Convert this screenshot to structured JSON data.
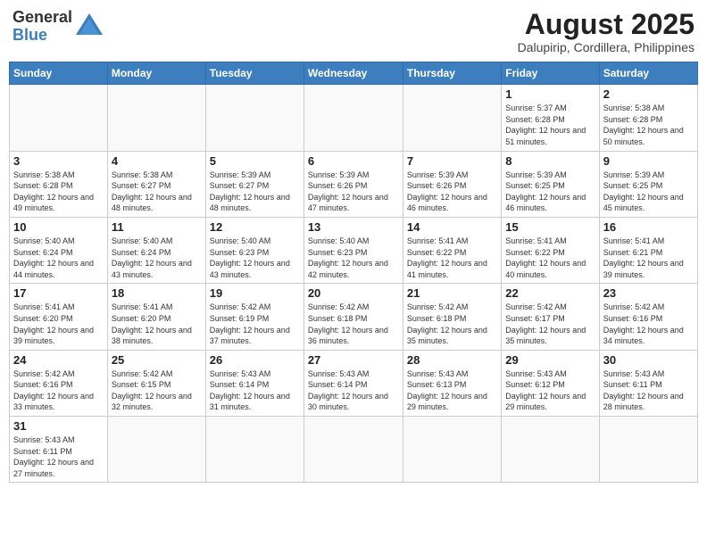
{
  "header": {
    "logo_general": "General",
    "logo_blue": "Blue",
    "month_title": "August 2025",
    "subtitle": "Dalupirip, Cordillera, Philippines"
  },
  "weekdays": [
    "Sunday",
    "Monday",
    "Tuesday",
    "Wednesday",
    "Thursday",
    "Friday",
    "Saturday"
  ],
  "weeks": [
    [
      {
        "day": "",
        "sunrise": "",
        "sunset": "",
        "daylight": ""
      },
      {
        "day": "",
        "sunrise": "",
        "sunset": "",
        "daylight": ""
      },
      {
        "day": "",
        "sunrise": "",
        "sunset": "",
        "daylight": ""
      },
      {
        "day": "",
        "sunrise": "",
        "sunset": "",
        "daylight": ""
      },
      {
        "day": "",
        "sunrise": "",
        "sunset": "",
        "daylight": ""
      },
      {
        "day": "1",
        "sunrise": "Sunrise: 5:37 AM",
        "sunset": "Sunset: 6:28 PM",
        "daylight": "Daylight: 12 hours and 51 minutes."
      },
      {
        "day": "2",
        "sunrise": "Sunrise: 5:38 AM",
        "sunset": "Sunset: 6:28 PM",
        "daylight": "Daylight: 12 hours and 50 minutes."
      }
    ],
    [
      {
        "day": "3",
        "sunrise": "Sunrise: 5:38 AM",
        "sunset": "Sunset: 6:28 PM",
        "daylight": "Daylight: 12 hours and 49 minutes."
      },
      {
        "day": "4",
        "sunrise": "Sunrise: 5:38 AM",
        "sunset": "Sunset: 6:27 PM",
        "daylight": "Daylight: 12 hours and 48 minutes."
      },
      {
        "day": "5",
        "sunrise": "Sunrise: 5:39 AM",
        "sunset": "Sunset: 6:27 PM",
        "daylight": "Daylight: 12 hours and 48 minutes."
      },
      {
        "day": "6",
        "sunrise": "Sunrise: 5:39 AM",
        "sunset": "Sunset: 6:26 PM",
        "daylight": "Daylight: 12 hours and 47 minutes."
      },
      {
        "day": "7",
        "sunrise": "Sunrise: 5:39 AM",
        "sunset": "Sunset: 6:26 PM",
        "daylight": "Daylight: 12 hours and 46 minutes."
      },
      {
        "day": "8",
        "sunrise": "Sunrise: 5:39 AM",
        "sunset": "Sunset: 6:25 PM",
        "daylight": "Daylight: 12 hours and 46 minutes."
      },
      {
        "day": "9",
        "sunrise": "Sunrise: 5:39 AM",
        "sunset": "Sunset: 6:25 PM",
        "daylight": "Daylight: 12 hours and 45 minutes."
      }
    ],
    [
      {
        "day": "10",
        "sunrise": "Sunrise: 5:40 AM",
        "sunset": "Sunset: 6:24 PM",
        "daylight": "Daylight: 12 hours and 44 minutes."
      },
      {
        "day": "11",
        "sunrise": "Sunrise: 5:40 AM",
        "sunset": "Sunset: 6:24 PM",
        "daylight": "Daylight: 12 hours and 43 minutes."
      },
      {
        "day": "12",
        "sunrise": "Sunrise: 5:40 AM",
        "sunset": "Sunset: 6:23 PM",
        "daylight": "Daylight: 12 hours and 43 minutes."
      },
      {
        "day": "13",
        "sunrise": "Sunrise: 5:40 AM",
        "sunset": "Sunset: 6:23 PM",
        "daylight": "Daylight: 12 hours and 42 minutes."
      },
      {
        "day": "14",
        "sunrise": "Sunrise: 5:41 AM",
        "sunset": "Sunset: 6:22 PM",
        "daylight": "Daylight: 12 hours and 41 minutes."
      },
      {
        "day": "15",
        "sunrise": "Sunrise: 5:41 AM",
        "sunset": "Sunset: 6:22 PM",
        "daylight": "Daylight: 12 hours and 40 minutes."
      },
      {
        "day": "16",
        "sunrise": "Sunrise: 5:41 AM",
        "sunset": "Sunset: 6:21 PM",
        "daylight": "Daylight: 12 hours and 39 minutes."
      }
    ],
    [
      {
        "day": "17",
        "sunrise": "Sunrise: 5:41 AM",
        "sunset": "Sunset: 6:20 PM",
        "daylight": "Daylight: 12 hours and 39 minutes."
      },
      {
        "day": "18",
        "sunrise": "Sunrise: 5:41 AM",
        "sunset": "Sunset: 6:20 PM",
        "daylight": "Daylight: 12 hours and 38 minutes."
      },
      {
        "day": "19",
        "sunrise": "Sunrise: 5:42 AM",
        "sunset": "Sunset: 6:19 PM",
        "daylight": "Daylight: 12 hours and 37 minutes."
      },
      {
        "day": "20",
        "sunrise": "Sunrise: 5:42 AM",
        "sunset": "Sunset: 6:18 PM",
        "daylight": "Daylight: 12 hours and 36 minutes."
      },
      {
        "day": "21",
        "sunrise": "Sunrise: 5:42 AM",
        "sunset": "Sunset: 6:18 PM",
        "daylight": "Daylight: 12 hours and 35 minutes."
      },
      {
        "day": "22",
        "sunrise": "Sunrise: 5:42 AM",
        "sunset": "Sunset: 6:17 PM",
        "daylight": "Daylight: 12 hours and 35 minutes."
      },
      {
        "day": "23",
        "sunrise": "Sunrise: 5:42 AM",
        "sunset": "Sunset: 6:16 PM",
        "daylight": "Daylight: 12 hours and 34 minutes."
      }
    ],
    [
      {
        "day": "24",
        "sunrise": "Sunrise: 5:42 AM",
        "sunset": "Sunset: 6:16 PM",
        "daylight": "Daylight: 12 hours and 33 minutes."
      },
      {
        "day": "25",
        "sunrise": "Sunrise: 5:42 AM",
        "sunset": "Sunset: 6:15 PM",
        "daylight": "Daylight: 12 hours and 32 minutes."
      },
      {
        "day": "26",
        "sunrise": "Sunrise: 5:43 AM",
        "sunset": "Sunset: 6:14 PM",
        "daylight": "Daylight: 12 hours and 31 minutes."
      },
      {
        "day": "27",
        "sunrise": "Sunrise: 5:43 AM",
        "sunset": "Sunset: 6:14 PM",
        "daylight": "Daylight: 12 hours and 30 minutes."
      },
      {
        "day": "28",
        "sunrise": "Sunrise: 5:43 AM",
        "sunset": "Sunset: 6:13 PM",
        "daylight": "Daylight: 12 hours and 29 minutes."
      },
      {
        "day": "29",
        "sunrise": "Sunrise: 5:43 AM",
        "sunset": "Sunset: 6:12 PM",
        "daylight": "Daylight: 12 hours and 29 minutes."
      },
      {
        "day": "30",
        "sunrise": "Sunrise: 5:43 AM",
        "sunset": "Sunset: 6:11 PM",
        "daylight": "Daylight: 12 hours and 28 minutes."
      }
    ],
    [
      {
        "day": "31",
        "sunrise": "Sunrise: 5:43 AM",
        "sunset": "Sunset: 6:11 PM",
        "daylight": "Daylight: 12 hours and 27 minutes."
      },
      {
        "day": "",
        "sunrise": "",
        "sunset": "",
        "daylight": ""
      },
      {
        "day": "",
        "sunrise": "",
        "sunset": "",
        "daylight": ""
      },
      {
        "day": "",
        "sunrise": "",
        "sunset": "",
        "daylight": ""
      },
      {
        "day": "",
        "sunrise": "",
        "sunset": "",
        "daylight": ""
      },
      {
        "day": "",
        "sunrise": "",
        "sunset": "",
        "daylight": ""
      },
      {
        "day": "",
        "sunrise": "",
        "sunset": "",
        "daylight": ""
      }
    ]
  ]
}
